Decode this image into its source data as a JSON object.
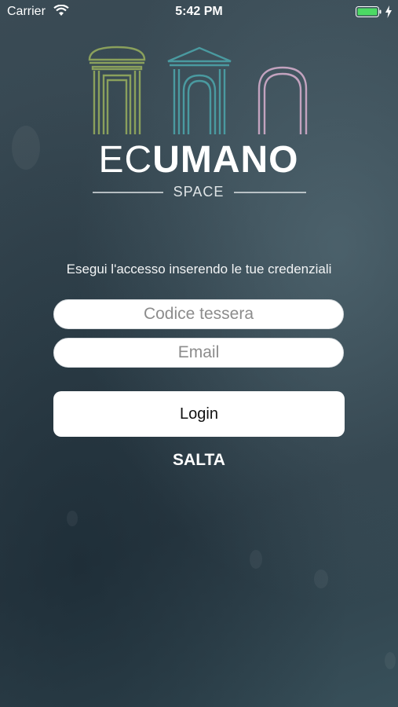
{
  "status_bar": {
    "carrier": "Carrier",
    "time": "5:42 PM",
    "battery_color": "#4cd964"
  },
  "logo": {
    "word_light": "EC",
    "word_bold": "UMANO",
    "subtitle": "SPACE",
    "arch_colors": [
      "#8aa05c",
      "#4a9aa0",
      "#c3a3bf"
    ]
  },
  "login": {
    "instructions": "Esegui l'accesso inserendo le tue credenziali",
    "code_placeholder": "Codice tessera",
    "email_placeholder": "Email",
    "login_label": "Login",
    "skip_label": "SALTA"
  }
}
